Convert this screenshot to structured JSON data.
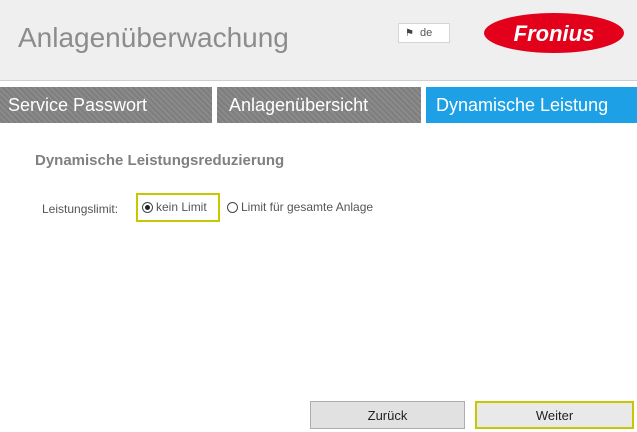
{
  "header": {
    "title": "Anlagenüberwachung",
    "language": "de",
    "logo_text": "Fronius",
    "logo_color": "#e2001a"
  },
  "tabs": [
    {
      "label": "Service Passwort",
      "active": false
    },
    {
      "label": "Anlagenübersicht",
      "active": false
    },
    {
      "label": "Dynamische Leistung",
      "active": true
    }
  ],
  "main": {
    "section_title": "Dynamische Leistungsreduzierung",
    "limit_label": "Leistungslimit:",
    "options": [
      {
        "label": "kein Limit",
        "selected": true
      },
      {
        "label": "Limit für gesamte Anlage",
        "selected": false
      }
    ]
  },
  "buttons": {
    "back": "Zurück",
    "next": "Weiter"
  },
  "colors": {
    "active_tab": "#1ea0e6",
    "highlight": "#c8c800"
  }
}
